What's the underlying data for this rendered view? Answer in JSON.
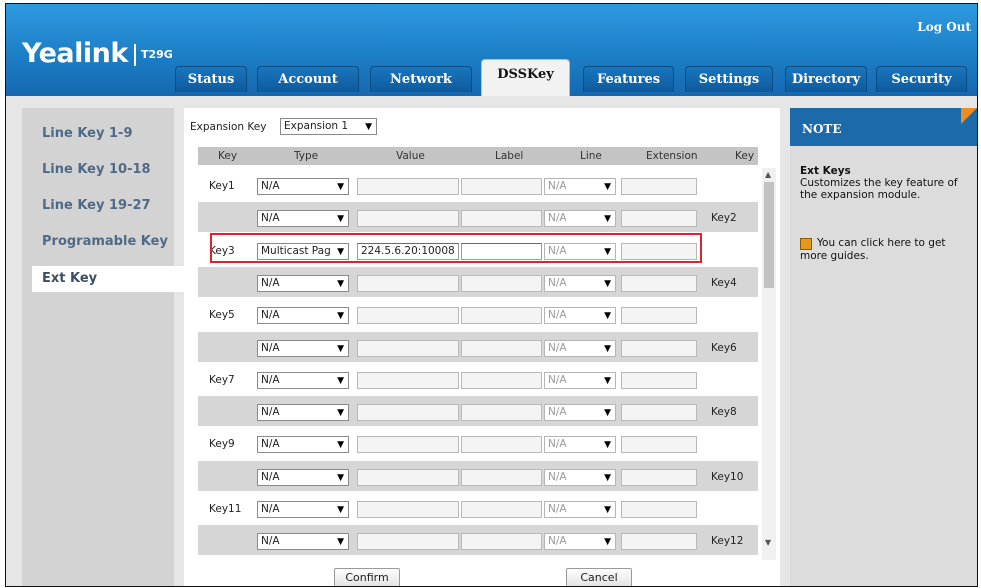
{
  "header": {
    "logo": "Yealink",
    "model": "T29G",
    "logout": "Log Out",
    "tabs": [
      "Status",
      "Account",
      "Network",
      "DSSKey",
      "Features",
      "Settings",
      "Directory",
      "Security"
    ],
    "active_tab": "DSSKey"
  },
  "sidebar": {
    "items": [
      "Line Key 1-9",
      "Line Key 10-18",
      "Line Key 19-27",
      "Programable Key",
      "Ext Key"
    ],
    "active": "Ext Key"
  },
  "main": {
    "expansion_label": "Expansion Key",
    "expansion_value": "Expansion 1",
    "columns": [
      "Key",
      "Type",
      "Value",
      "Label",
      "Line",
      "Extension",
      "Key"
    ],
    "rows": [
      {
        "key": "Key1",
        "type": "N/A",
        "value": "",
        "label": "",
        "line": "N/A",
        "extension": "",
        "side": "left"
      },
      {
        "key": "Key2",
        "type": "N/A",
        "value": "",
        "label": "",
        "line": "N/A",
        "extension": "",
        "side": "right"
      },
      {
        "key": "Key3",
        "type": "Multicast Pag",
        "value": "224.5.6.20:10008",
        "label": "",
        "line": "N/A",
        "extension": "",
        "side": "left"
      },
      {
        "key": "Key4",
        "type": "N/A",
        "value": "",
        "label": "",
        "line": "N/A",
        "extension": "",
        "side": "right"
      },
      {
        "key": "Key5",
        "type": "N/A",
        "value": "",
        "label": "",
        "line": "N/A",
        "extension": "",
        "side": "left"
      },
      {
        "key": "Key6",
        "type": "N/A",
        "value": "",
        "label": "",
        "line": "N/A",
        "extension": "",
        "side": "right"
      },
      {
        "key": "Key7",
        "type": "N/A",
        "value": "",
        "label": "",
        "line": "N/A",
        "extension": "",
        "side": "left"
      },
      {
        "key": "Key8",
        "type": "N/A",
        "value": "",
        "label": "",
        "line": "N/A",
        "extension": "",
        "side": "right"
      },
      {
        "key": "Key9",
        "type": "N/A",
        "value": "",
        "label": "",
        "line": "N/A",
        "extension": "",
        "side": "left"
      },
      {
        "key": "Key10",
        "type": "N/A",
        "value": "",
        "label": "",
        "line": "N/A",
        "extension": "",
        "side": "right"
      },
      {
        "key": "Key11",
        "type": "N/A",
        "value": "",
        "label": "",
        "line": "N/A",
        "extension": "",
        "side": "left"
      },
      {
        "key": "Key12",
        "type": "N/A",
        "value": "",
        "label": "",
        "line": "N/A",
        "extension": "",
        "side": "right"
      }
    ],
    "confirm": "Confirm",
    "cancel": "Cancel"
  },
  "note": {
    "heading": "NOTE",
    "title": "Ext Keys",
    "text": "Customizes the key feature of the expansion module.",
    "guide": "You can click here to get more guides."
  },
  "colors": {
    "header_blue": "#1c7fc6",
    "highlight_red": "#d9262a",
    "note_accent": "#f28b1e"
  }
}
